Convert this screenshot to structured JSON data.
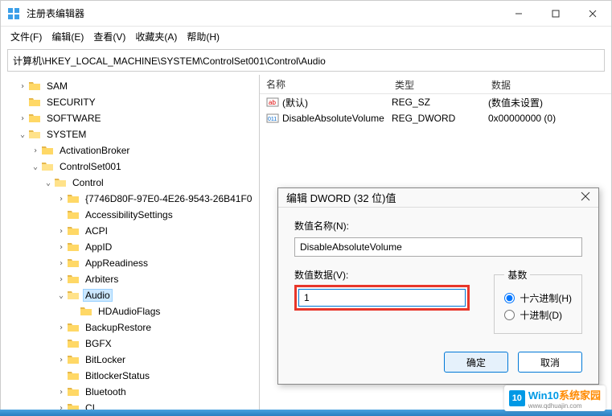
{
  "window": {
    "title": "注册表编辑器"
  },
  "menu": {
    "file": "文件(F)",
    "edit": "编辑(E)",
    "view": "查看(V)",
    "favorites": "收藏夹(A)",
    "help": "帮助(H)"
  },
  "path": "计算机\\HKEY_LOCAL_MACHINE\\SYSTEM\\ControlSet001\\Control\\Audio",
  "tree": {
    "n0": "SAM",
    "n1": "SECURITY",
    "n2": "SOFTWARE",
    "n3": "SYSTEM",
    "n4": "ActivationBroker",
    "n5": "ControlSet001",
    "n6": "Control",
    "n7": "{7746D80F-97E0-4E26-9543-26B41F0",
    "n8": "AccessibilitySettings",
    "n9": "ACPI",
    "n10": "AppID",
    "n11": "AppReadiness",
    "n12": "Arbiters",
    "n13": "Audio",
    "n14": "HDAudioFlags",
    "n15": "BackupRestore",
    "n16": "BGFX",
    "n17": "BitLocker",
    "n18": "BitlockerStatus",
    "n19": "Bluetooth",
    "n20": "CI"
  },
  "list": {
    "col_name": "名称",
    "col_type": "类型",
    "col_data": "数据",
    "r0_name": "(默认)",
    "r0_type": "REG_SZ",
    "r0_data": "(数值未设置)",
    "r1_name": "DisableAbsoluteVolume",
    "r1_type": "REG_DWORD",
    "r1_data": "0x00000000 (0)"
  },
  "dialog": {
    "title": "编辑 DWORD (32 位)值",
    "name_label": "数值名称(N):",
    "name_value": "DisableAbsoluteVolume",
    "value_label": "数值数据(V):",
    "value": "1",
    "base_label": "基数",
    "hex": "十六进制(H)",
    "dec": "十进制(D)",
    "ok": "确定",
    "cancel": "取消"
  },
  "watermark": {
    "blue": "Win10",
    "orange": "系统家园",
    "sub": "www.qdhuajin.com"
  }
}
